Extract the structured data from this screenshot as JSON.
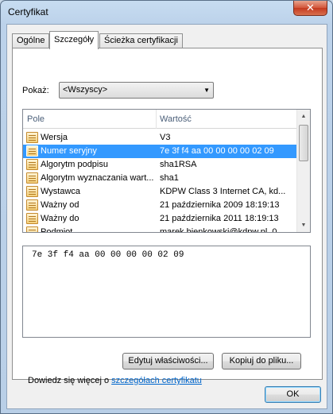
{
  "window": {
    "title": "Certyfikat",
    "close_symbol": "✕"
  },
  "tabs": [
    {
      "label": "Ogólne",
      "active": false
    },
    {
      "label": "Szczegóły",
      "active": true
    },
    {
      "label": "Ścieżka certyfikacji",
      "active": false
    }
  ],
  "show": {
    "label": "Pokaż:",
    "selected": "<Wszyscy>",
    "arrow": "▼"
  },
  "list": {
    "columns": [
      "Pole",
      "Wartość"
    ],
    "rows": [
      {
        "field": "Wersja",
        "value": "V3",
        "selected": false
      },
      {
        "field": "Numer seryjny",
        "value": "7e 3f f4 aa 00 00 00 00 02 09",
        "selected": true
      },
      {
        "field": "Algorytm podpisu",
        "value": "sha1RSA",
        "selected": false
      },
      {
        "field": "Algorytm wyznaczania wart...",
        "value": "sha1",
        "selected": false
      },
      {
        "field": "Wystawca",
        "value": "KDPW Class 3 Internet CA, kd...",
        "selected": false
      },
      {
        "field": "Ważny od",
        "value": "21 października 2009 18:19:13",
        "selected": false
      },
      {
        "field": "Ważny do",
        "value": "21 października 2011 18:19:13",
        "selected": false
      },
      {
        "field": "Podmiot",
        "value": "marek.bienkowski@kdpw.pl, 0...",
        "selected": false
      }
    ],
    "scroll_up": "▲",
    "scroll_down": "▼"
  },
  "value_box": {
    "text": "7e 3f f4 aa 00 00 00 00 02 09"
  },
  "buttons": {
    "edit": "Edytuj właściwości...",
    "copy": "Kopiuj do pliku...",
    "ok": "OK"
  },
  "learn": {
    "prefix": "Dowiedz się więcej o ",
    "link": "szczegółach certyfikatu"
  },
  "colors": {
    "selection": "#3399ff",
    "link": "#0066cc"
  }
}
